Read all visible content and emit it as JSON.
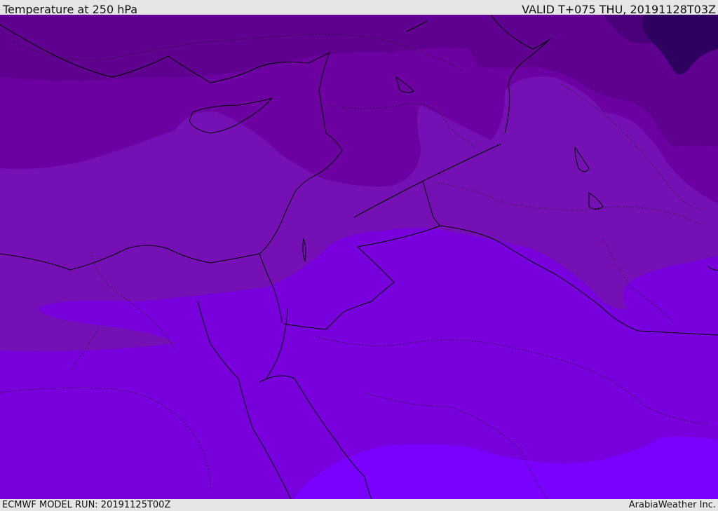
{
  "header": {
    "title": "Temperature at 250 hPa",
    "valid": "VALID T+075 THU, 20191128T03Z"
  },
  "footer": {
    "model_run": "ECMWF MODEL RUN: 20191125T00Z",
    "credit": "ArabiaWeather Inc."
  },
  "map": {
    "field": "temperature",
    "level": "250 hPa",
    "band_colors": {
      "darkest": "#2e0060",
      "darker": "#4a0078",
      "dark": "#600090",
      "mid_dark": "#6c00a0",
      "mid": "#7510b5",
      "bright": "#7700dd",
      "brightest": "#7a00ff"
    },
    "coastline_color": "#000000",
    "border_style": "dotted"
  }
}
